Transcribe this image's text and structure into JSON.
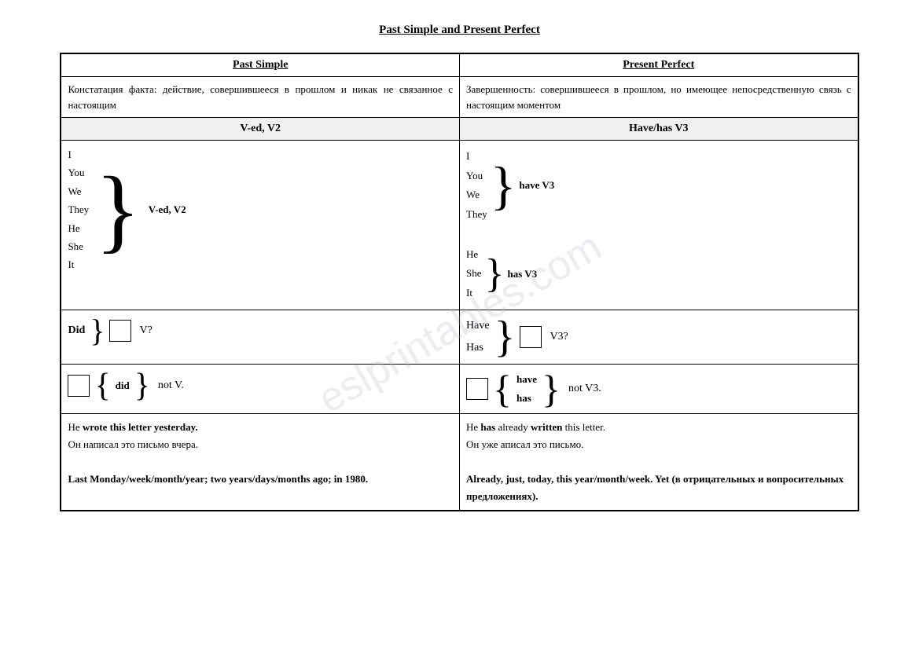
{
  "title": "Past Simple and Present Perfect",
  "watermark": "eslprintables.com",
  "columns": {
    "past_simple": "Past Simple",
    "present_perfect": "Present Perfect"
  },
  "rows": {
    "description": {
      "past": "Констатация факта: действие, совершившееся в прошлом и никак не связанное с настоящим",
      "present": "Завершенность: совершившееся в прошлом, но имеющее непосредственную связь с настоящим моментом"
    },
    "formula": {
      "past": "V-ed, V2",
      "present": "Have/has V3"
    },
    "pronouns_past": {
      "group1": [
        "I",
        "You",
        "We",
        "They"
      ],
      "group2": [
        "He",
        "She",
        "It"
      ],
      "formula": "V-ed, V2"
    },
    "pronouns_present": {
      "group1": [
        "I",
        "You",
        "We",
        "They"
      ],
      "group2": [
        "He",
        "She",
        "It"
      ],
      "formula1": "have  V3",
      "formula2": "has V3"
    },
    "question": {
      "past_aux": "Did",
      "past_v": "V?",
      "present_aux1": "Have",
      "present_aux2": "Has",
      "present_v": "V3?"
    },
    "negative": {
      "past_did": "did",
      "past_not": "not V.",
      "present_have": "have",
      "present_has": "has",
      "present_not": "not V3."
    },
    "examples": {
      "past_sentence": "He wrote this letter yesterday.",
      "past_translation": "Он написал это письмо вчера.",
      "past_bold_words": [
        "wrote",
        "this letter yesterday."
      ],
      "present_sentence1": "He has already written this letter.",
      "present_sentence2": "Он уже aписал это письмо.",
      "present_bold_words": [
        "has",
        "written"
      ]
    },
    "time_markers": {
      "past": "Last Monday/week/month/year; two years/days/months ago; in 1980.",
      "past_bold": [
        "Last Monday/week/month/year;",
        "two years/days/months ago;",
        "in 1980."
      ],
      "present": "Already, just, today, this year/month/week. Yet (в отрицательных и вопросительных предложениях).",
      "present_bold": [
        "Already, just, today, this year/month/week.",
        "Yet (в отрицательных и вопросительных предложениях)."
      ]
    }
  }
}
